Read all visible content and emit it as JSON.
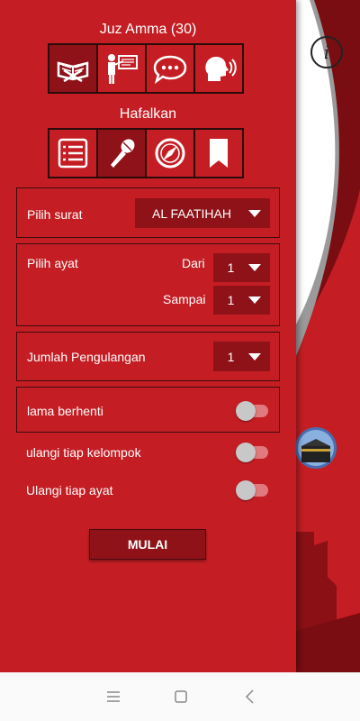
{
  "section1": {
    "title": "Juz Amma (30)",
    "icons": [
      "quran-book-icon",
      "teacher-board-icon",
      "chat-bubble-icon",
      "speaking-head-icon"
    ],
    "active_index": 0
  },
  "section2": {
    "title": "Hafalkan",
    "icons": [
      "list-icon",
      "microphone-icon",
      "compass-icon",
      "bookmark-icon"
    ],
    "active_index": 1
  },
  "surah": {
    "label": "Pilih surat",
    "value": "AL FAATIHAH"
  },
  "ayat": {
    "label": "Pilih ayat",
    "from_label": "Dari",
    "from_value": "1",
    "to_label": "Sampai",
    "to_value": "1"
  },
  "repeat": {
    "label": "Jumlah Pengulangan",
    "value": "1"
  },
  "toggles": {
    "pause": {
      "label": "lama berhenti",
      "on": false
    },
    "group": {
      "label": "ulangi tiap kelompok",
      "on": false
    },
    "verse": {
      "label": "Ulangi tiap ayat",
      "on": false
    }
  },
  "start_button": "MULAI",
  "info_icon_glyph": "i",
  "colors": {
    "primary": "#c41e24",
    "dark": "#8e1218",
    "light_red": "#e07a7e"
  }
}
